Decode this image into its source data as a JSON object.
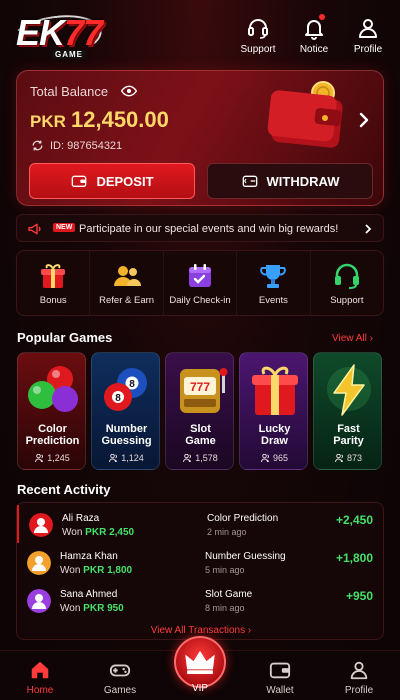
{
  "header": {
    "logo_text": "EK",
    "logo_num": "77",
    "logo_sub": "GAME",
    "support_label": "Support",
    "notice_label": "Notice",
    "profile_label": "Profile"
  },
  "balance": {
    "label": "Total Balance",
    "currency": "PKR",
    "amount": "12,450.00",
    "id_text": "ID: 987654321",
    "deposit_label": "DEPOSIT",
    "withdraw_label": "WITHDRAW"
  },
  "announcement": {
    "badge": "NEW",
    "text": "Participate in our special events and win big rewards!"
  },
  "quick_actions": [
    {
      "label": "Bonus",
      "icon": "gift-icon"
    },
    {
      "label": "Refer & Earn",
      "icon": "users-icon"
    },
    {
      "label": "Daily Check-in",
      "icon": "calendar-check-icon"
    },
    {
      "label": "Events",
      "icon": "trophy-icon"
    },
    {
      "label": "Support",
      "icon": "headset-icon"
    }
  ],
  "popular": {
    "title": "Popular Games",
    "view_all": "View All"
  },
  "games": [
    {
      "name_line1": "Color",
      "name_line2": "Prediction",
      "players": "1,245"
    },
    {
      "name_line1": "Number",
      "name_line2": "Guessing",
      "players": "1,124"
    },
    {
      "name_line1": "Slot",
      "name_line2": "Game",
      "players": "1,578"
    },
    {
      "name_line1": "Lucky",
      "name_line2": "Draw",
      "players": "965"
    },
    {
      "name_line1": "Fast",
      "name_line2": "Parity",
      "players": "873"
    }
  ],
  "recent": {
    "title": "Recent Activity",
    "rows": [
      {
        "name": "Ali Raza",
        "won_prefix": "Won",
        "won_amount": "PKR 2,450",
        "game": "Color Prediction",
        "time": "2 min ago",
        "gain": "+2,450"
      },
      {
        "name": "Hamza Khan",
        "won_prefix": "Won",
        "won_amount": "PKR 1,800",
        "game": "Number Guessing",
        "time": "5 min ago",
        "gain": "+1,800"
      },
      {
        "name": "Sana Ahmed",
        "won_prefix": "Won",
        "won_amount": "PKR 950",
        "game": "Slot Game",
        "time": "8 min ago",
        "gain": "+950"
      }
    ],
    "view_all_tx": "View All Transactions"
  },
  "nav": {
    "home": "Home",
    "games": "Games",
    "vip": "VIP",
    "wallet": "Wallet",
    "profile": "Profile"
  },
  "colors": {
    "accent_red": "#e0191f",
    "gold": "#ffd86a",
    "win_green": "#46e06a"
  }
}
